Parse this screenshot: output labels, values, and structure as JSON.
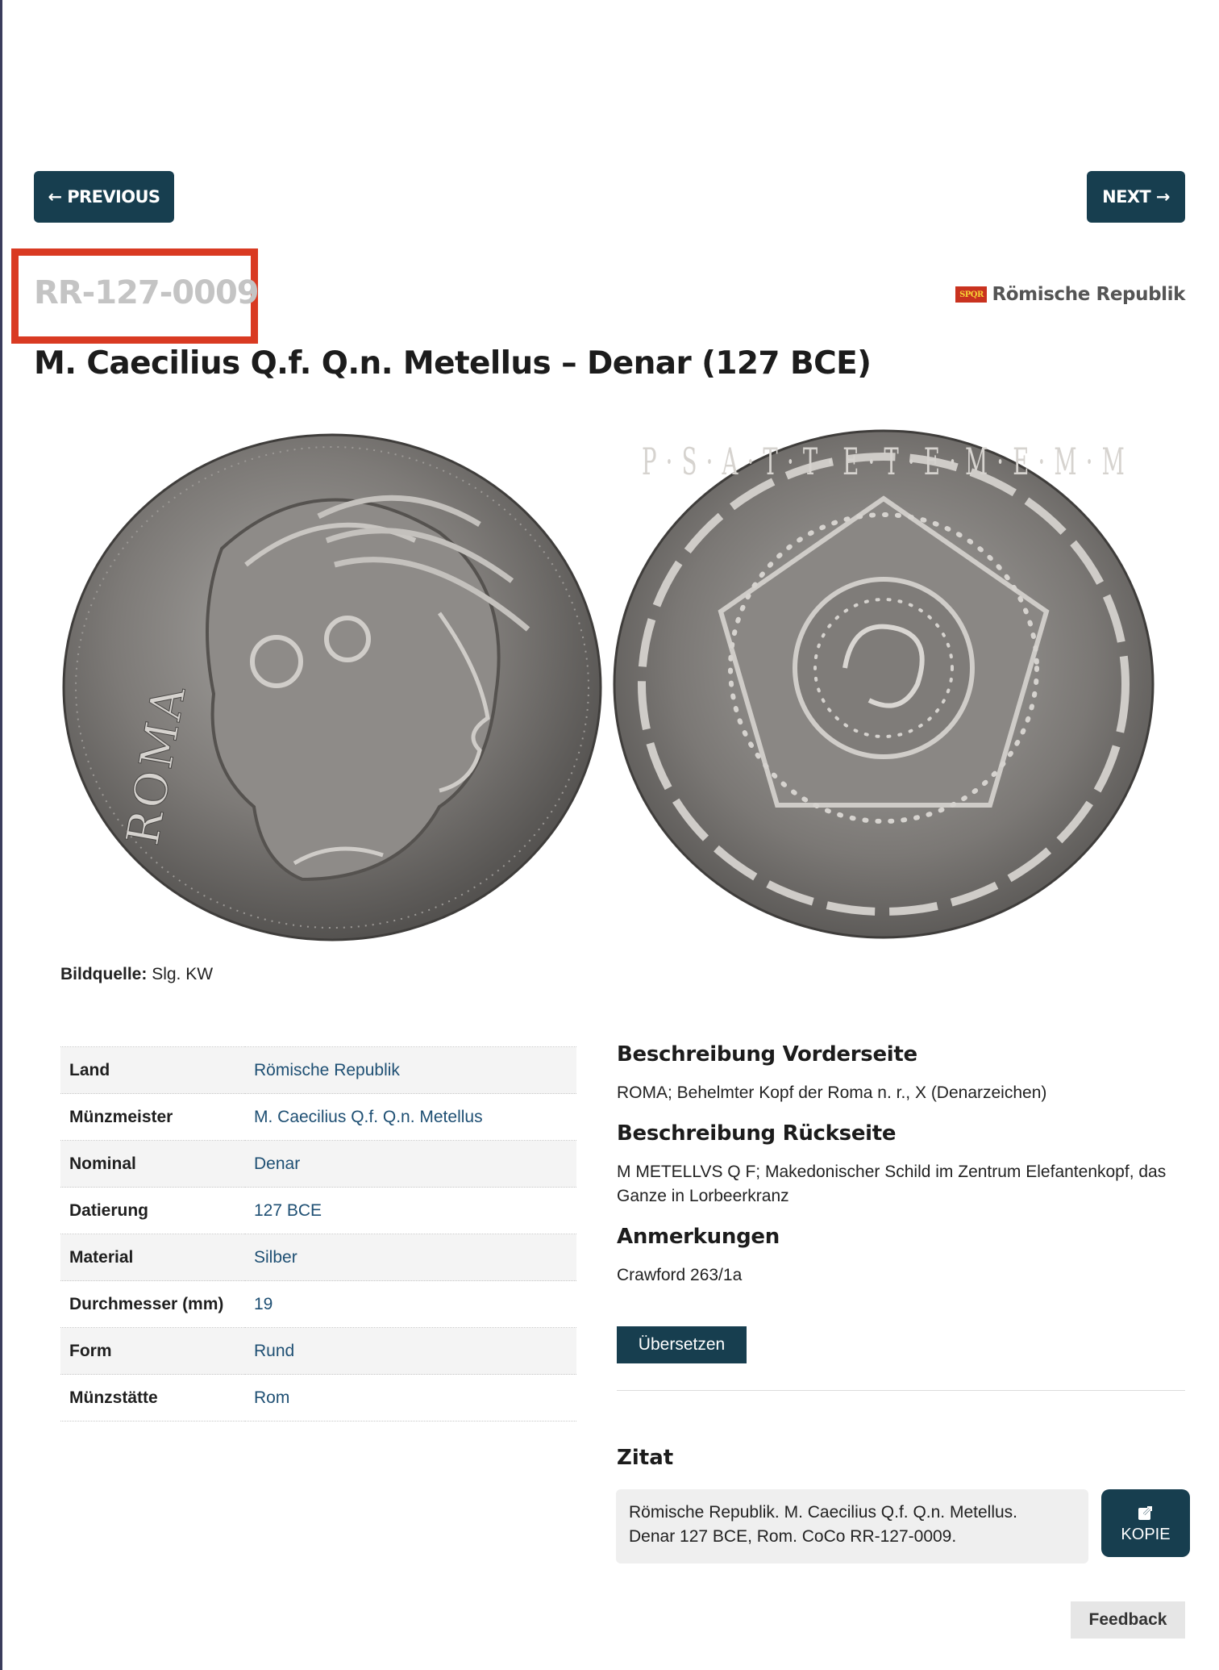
{
  "nav": {
    "previous_label": "← PREVIOUS",
    "next_label": "NEXT →"
  },
  "coin": {
    "id": "RR-127-0009",
    "category_badge": "SPQR",
    "category": "Römische Republik",
    "title": "M. Caecilius Q.f. Q.n. Metellus – Denar (127 BCE)",
    "obverse_legend": "ROMA",
    "reverse_legend": "P · S · A · T · T · E · T · E · M · E · M · M"
  },
  "image_source": {
    "label": "Bildquelle:",
    "value": "Slg. KW"
  },
  "properties": [
    {
      "key": "Land",
      "value": "Römische Republik"
    },
    {
      "key": "Münzmeister",
      "value": "M. Caecilius Q.f. Q.n. Metellus"
    },
    {
      "key": "Nominal",
      "value": "Denar"
    },
    {
      "key": "Datierung",
      "value": "127 BCE"
    },
    {
      "key": "Material",
      "value": "Silber"
    },
    {
      "key": "Durchmesser (mm)",
      "value": "19"
    },
    {
      "key": "Form",
      "value": "Rund"
    },
    {
      "key": "Münzstätte",
      "value": "Rom"
    }
  ],
  "description": {
    "obverse_heading": "Beschreibung Vorderseite",
    "obverse_text": "ROMA; Behelmter Kopf der Roma n. r., X (Denarzeichen)",
    "reverse_heading": "Beschreibung Rückseite",
    "reverse_text": "M METELLVS Q F; Makedonischer Schild im Zentrum Elefantenkopf, das Ganze in Lorbeerkranz",
    "notes_heading": "Anmerkungen",
    "notes_text": "Crawford 263/1a"
  },
  "translate_label": "Übersetzen",
  "citation": {
    "heading": "Zitat",
    "line1": "Römische Republik. M. Caecilius Q.f. Q.n. Metellus.",
    "line2": "Denar 127 BCE, Rom. CoCo RR-127-0009.",
    "copy_label": "KOPIE"
  },
  "feedback_label": "Feedback",
  "colors": {
    "primary": "#173e4f",
    "link": "#1e4f73",
    "highlight": "#d93a22",
    "badge": "#c9321f"
  }
}
